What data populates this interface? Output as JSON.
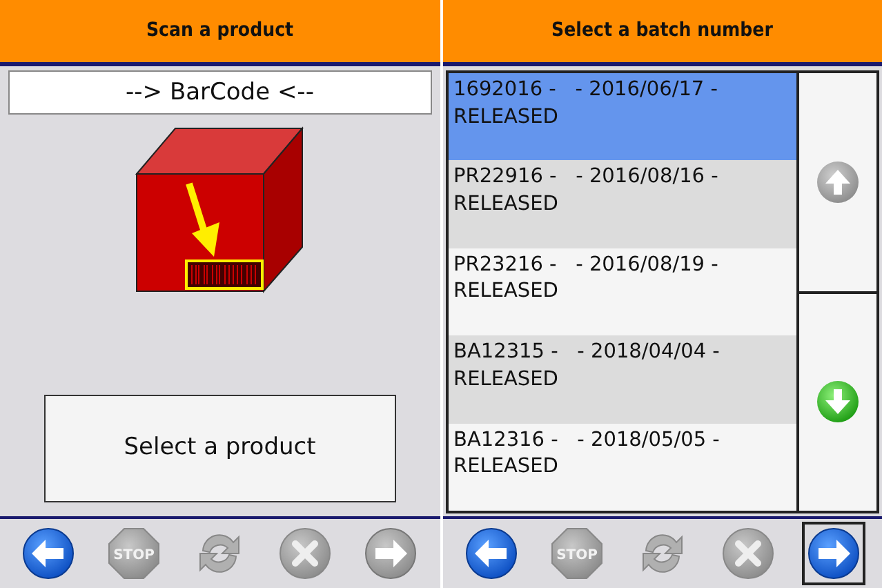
{
  "left_panel": {
    "title": "Scan a product",
    "barcode_field": {
      "value": "--> BarCode <--"
    },
    "action_button": "Select a product",
    "toolbar": [
      {
        "kind": "back",
        "disabled": false,
        "focused": false
      },
      {
        "kind": "stop",
        "label": "STOP",
        "disabled": true,
        "focused": false
      },
      {
        "kind": "refresh",
        "disabled": true,
        "focused": false
      },
      {
        "kind": "cancel",
        "disabled": true,
        "focused": false
      },
      {
        "kind": "next",
        "disabled": true,
        "focused": false
      }
    ]
  },
  "right_panel": {
    "title": "Select a batch number",
    "batches": [
      {
        "text": "1692016 -   - 2016/06/17 - RELEASED",
        "selected": true
      },
      {
        "text": "PR22916 -   - 2016/08/16 - RELEASED",
        "selected": false
      },
      {
        "text": "PR23216 -   - 2016/08/19 - RELEASED",
        "selected": false
      },
      {
        "text": "BA12315 -   - 2018/04/04 - RELEASED",
        "selected": false
      },
      {
        "text": "BA12316 -   - 2018/05/05 - RELEASED",
        "selected": false
      }
    ],
    "scroll_buttons": [
      {
        "kind": "up",
        "disabled": true
      },
      {
        "kind": "down",
        "disabled": false
      }
    ],
    "toolbar": [
      {
        "kind": "back",
        "disabled": false,
        "focused": false
      },
      {
        "kind": "stop",
        "label": "STOP",
        "disabled": true,
        "focused": false
      },
      {
        "kind": "refresh",
        "disabled": true,
        "focused": false
      },
      {
        "kind": "cancel",
        "disabled": true,
        "focused": false
      },
      {
        "kind": "next",
        "disabled": false,
        "focused": true
      }
    ]
  }
}
